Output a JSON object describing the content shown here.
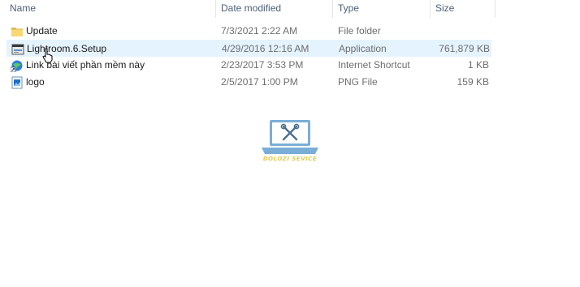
{
  "columns": {
    "name": "Name",
    "date_modified": "Date modified",
    "type": "Type",
    "size": "Size"
  },
  "files": [
    {
      "name": "Update",
      "date": "7/3/2021 2:22 AM",
      "type": "File folder",
      "size": "",
      "icon": "folder-icon",
      "selected": false
    },
    {
      "name": "Lightroom.6.Setup",
      "date": "4/29/2016 12:16 AM",
      "type": "Application",
      "size": "761,879 KB",
      "icon": "installer-icon",
      "selected": true
    },
    {
      "name": "Link bài viết phần mềm này",
      "date": "2/23/2017 3:53 PM",
      "type": "Internet Shortcut",
      "size": "1 KB",
      "icon": "internet-shortcut-icon",
      "selected": false
    },
    {
      "name": "logo",
      "date": "2/5/2017 1:00 PM",
      "type": "PNG File",
      "size": "159 KB",
      "icon": "image-file-icon",
      "selected": false
    }
  ],
  "watermark": {
    "text": "DOLOZI SEVICE",
    "icon": "laptop-tools-icon",
    "color": "#e6c84a",
    "icon_color": "#7aaed6"
  },
  "colors": {
    "header_text": "#4c607a",
    "selection": "#e5f3ff",
    "folder": "#f8d775"
  }
}
